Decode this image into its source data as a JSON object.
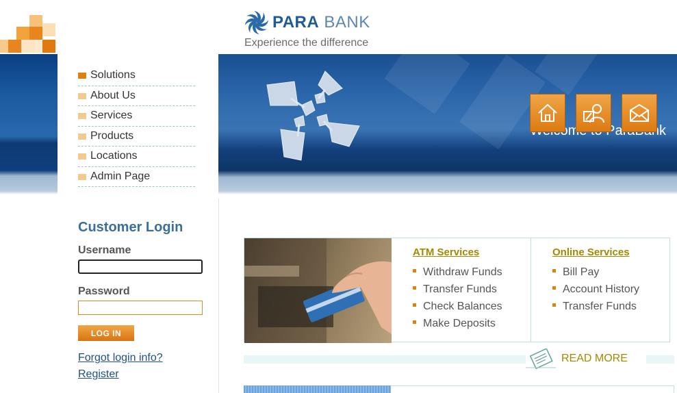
{
  "brand": {
    "name_part1": "PARA",
    "name_part2": "BANK",
    "tagline": "Experience the difference"
  },
  "nav": {
    "items": [
      {
        "label": "Solutions"
      },
      {
        "label": "About Us"
      },
      {
        "label": "Services"
      },
      {
        "label": "Products"
      },
      {
        "label": "Locations"
      },
      {
        "label": "Admin Page"
      }
    ]
  },
  "header": {
    "welcome": "Welcome to ParaBank",
    "icons": [
      "home-icon",
      "contact-icon",
      "mail-icon"
    ]
  },
  "login": {
    "title": "Customer Login",
    "username_label": "Username",
    "username_value": "",
    "password_label": "Password",
    "password_value": "",
    "button": "LOG IN",
    "forgot_link": "Forgot login info?",
    "register_link": "Register"
  },
  "services": {
    "atm": {
      "title": "ATM Services",
      "items": [
        "Withdraw Funds",
        "Transfer Funds",
        "Check Balances",
        "Make Deposits"
      ]
    },
    "online": {
      "title": "Online Services",
      "items": [
        "Bill Pay",
        "Account History",
        "Transfer Funds"
      ]
    },
    "read_more": "READ MORE"
  },
  "colors": {
    "accent": "#e0800f",
    "brand_blue": "#2a6aa8",
    "link": "#1e4f89",
    "service_title": "#a38900"
  }
}
